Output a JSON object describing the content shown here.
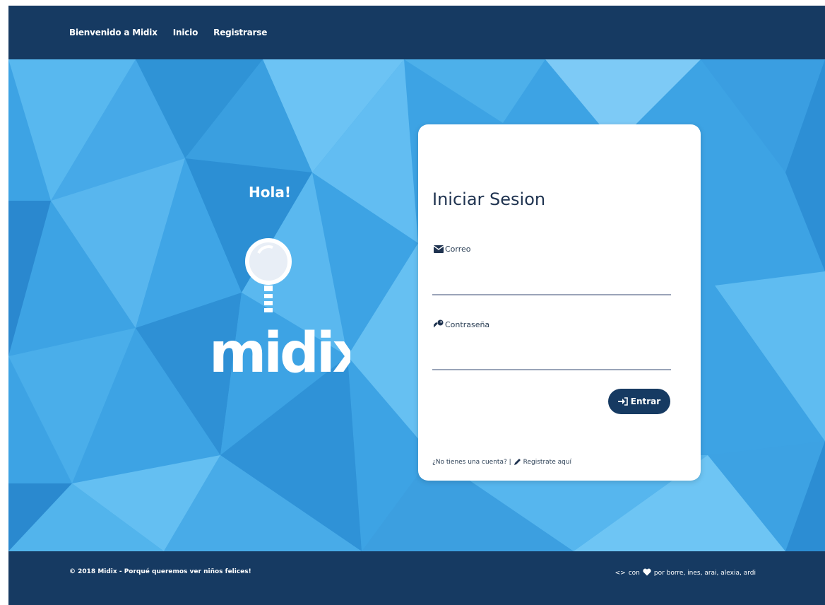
{
  "navbar": {
    "brand": "Bienvenido a Midix",
    "links": [
      "Inicio",
      "Registrarse"
    ]
  },
  "hero": {
    "greeting": "Hola!",
    "logo_text": "midix"
  },
  "login": {
    "title": "Iniciar Sesion",
    "email_label": "Correo",
    "email_value": "",
    "password_label": "Contraseña",
    "password_value": "",
    "submit_label": "Entrar",
    "no_account_text": "¿No tienes una cuenta? |",
    "register_link": "Registrate aquí"
  },
  "footer": {
    "copyright": "© 2018 Midix - Porqué queremos ver niños felices!",
    "code_symbol": "<>",
    "con": "con",
    "credits": "por borre, ines, arai, alexia, ardi"
  },
  "colors": {
    "navy": "#163a62",
    "hero_blue": "#3da3e4",
    "text_dark": "#1f3350"
  },
  "icons": [
    "envelope-icon",
    "key-icon",
    "sign-in-icon",
    "pencil-icon",
    "heart-icon",
    "code-icon"
  ]
}
